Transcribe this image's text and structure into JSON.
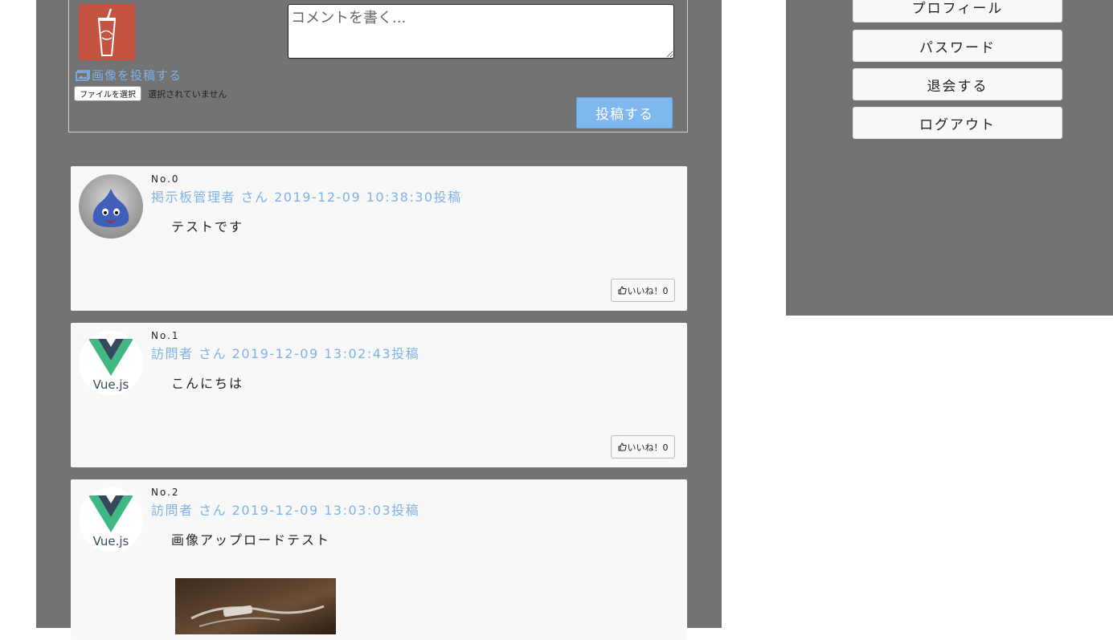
{
  "form": {
    "comment_placeholder": "コメントを書く...",
    "upload_label": "画像を投稿する",
    "file_button_label": "ファイルを選択",
    "file_status": "選択されていません",
    "submit_label": "投稿する",
    "avatar_icon": "drink-cup-avatar"
  },
  "posts": [
    {
      "no": "No.0",
      "meta": "掲示板管理者 さん 2019-12-09 10:38:30投稿",
      "body": "テストです",
      "like_label": "いいね！0",
      "avatar_icon": "slime-avatar"
    },
    {
      "no": "No.1",
      "meta": "訪問者 さん 2019-12-09 13:02:43投稿",
      "body": "こんにちは",
      "like_label": "いいね！0",
      "avatar_icon": "vuejs-logo-avatar"
    },
    {
      "no": "No.2",
      "meta": "訪問者 さん 2019-12-09 13:03:03投稿",
      "body": "画像アップロードテスト",
      "avatar_icon": "vuejs-logo-avatar",
      "vuejs_text": "Vue.js"
    }
  ],
  "vuejs_text": "Vue.js",
  "sidebar": {
    "items": [
      {
        "label": "プロフィール"
      },
      {
        "label": "パスワード"
      },
      {
        "label": "退会する"
      },
      {
        "label": "ログアウト"
      }
    ]
  },
  "colors": {
    "panel_bg": "#737373",
    "card_bg": "#f8f8f8",
    "accent_blue": "#7fb2e6",
    "submit_bg": "#7fb7ef"
  }
}
